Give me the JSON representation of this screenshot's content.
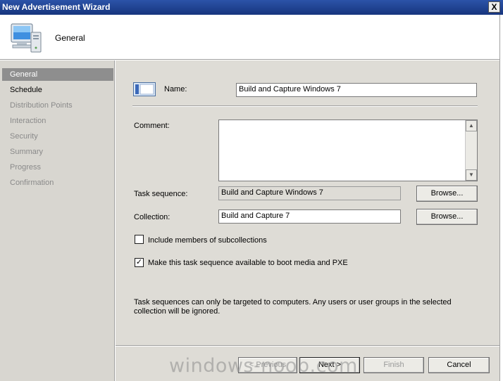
{
  "window": {
    "title": "New Advertisement Wizard",
    "close_glyph": "X"
  },
  "header": {
    "title": "General",
    "icon": "computer-icon"
  },
  "sidebar": {
    "items": [
      {
        "label": "General",
        "state": "active"
      },
      {
        "label": "Schedule",
        "state": "next"
      },
      {
        "label": "Distribution Points",
        "state": "disabled"
      },
      {
        "label": "Interaction",
        "state": "disabled"
      },
      {
        "label": "Security",
        "state": "disabled"
      },
      {
        "label": "Summary",
        "state": "disabled"
      },
      {
        "label": "Progress",
        "state": "disabled"
      },
      {
        "label": "Confirmation",
        "state": "disabled"
      }
    ]
  },
  "form": {
    "name_label": "Name:",
    "name_value": "Build and Capture Windows 7",
    "comment_label": "Comment:",
    "comment_value": "",
    "task_sequence_label": "Task sequence:",
    "task_sequence_value": "Build and Capture Windows 7",
    "collection_label": "Collection:",
    "collection_value": "Build and Capture 7",
    "browse_label": "Browse...",
    "include_subcollections_label": "Include members of subcollections",
    "include_subcollections_checked": false,
    "boot_media_label": "Make this task sequence available to boot media and PXE",
    "boot_media_checked": true,
    "note": "Task sequences can only be targeted to computers.  Any users or user groups in the selected collection will be ignored."
  },
  "footer": {
    "previous_label": "< Previous",
    "next_label": "Next >",
    "finish_label": "Finish",
    "cancel_label": "Cancel"
  },
  "watermark": "windows-noob.com",
  "colors": {
    "titlebar": "#1d3e8f",
    "sidebar_bg": "#d8d6d0",
    "content_bg": "#dedcd6",
    "nav_active": "#8e8e8e"
  }
}
